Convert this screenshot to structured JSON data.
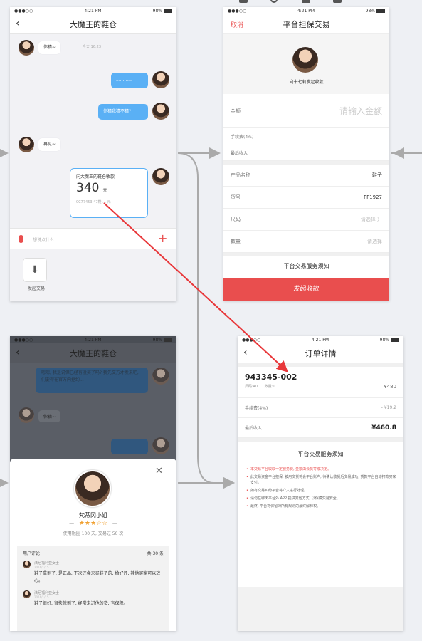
{
  "status": {
    "carrier": "●●●○○",
    "time": "4:21 PM",
    "battery": "98%"
  },
  "screen1": {
    "title": "大魔王的鞋仓",
    "messages": [
      {
        "side": "left",
        "text": "你猜~",
        "time": "今天 16:23"
      },
      {
        "side": "right",
        "text": "............"
      },
      {
        "side": "right",
        "text": "你猜我猜不猜?"
      },
      {
        "side": "left",
        "text": "再见~"
      }
    ],
    "card": {
      "title": "向大魔王的鞋仓收款",
      "amount": "340",
      "unit": "元",
      "order": "0C77453 47鞋 ... 元"
    },
    "input_placeholder": "想说点什么...",
    "tool_label": "发起交易"
  },
  "screen2": {
    "cancel": "取消",
    "title": "平台担保交易",
    "payee": "向十七莉发起收款",
    "amount_label": "金额",
    "amount_placeholder": "请输入金额",
    "fee_label": "手续费(4%)",
    "final_label": "最后收入",
    "rows": [
      {
        "label": "产品名称",
        "value": "鞋子",
        "placeholder": false
      },
      {
        "label": "货号",
        "value": "FF1927",
        "placeholder": false
      },
      {
        "label": "尺码",
        "value": "请选择 〉",
        "placeholder": true
      },
      {
        "label": "数量",
        "value": "请选择",
        "placeholder": true
      }
    ],
    "notice": "平台交易服务须知",
    "submit": "发起收款"
  },
  "screen3": {
    "title": "大魔王的鞋仓",
    "blue_text": "嗯嗯, 我是说但已经有没买了吗? 我先交方才发来吧, 们要得在官方内据约...",
    "reply": "你猜~",
    "seller": {
      "name": "梵蒂冈小姐",
      "stars": 3,
      "stars_text": "★★★☆☆",
      "stats": "使用融圈 100 天, 交易过 50 次",
      "reviews_title": "用户评论",
      "reviews_count": "共 30 条",
      "reviews": [
        {
          "user": "法尼福利亚女士",
          "date": "2016/1/15",
          "text": "鞋子拿到了, 是正品, 下次还会来买鞋子的, 给好评, 其他买家可以放心。"
        },
        {
          "user": "法尼福利亚女士",
          "date": "2016/1/15",
          "text": "鞋子很好, 很快就到了, 经常来进他的货, 有保障。"
        }
      ]
    }
  },
  "screen4": {
    "title": "订单详情",
    "order_no": "943345-002",
    "meta": "尺码:40      数量:1",
    "price": "¥480",
    "fee_label": "手续费(4%)",
    "fee_value": "- ¥19.2",
    "final_label": "最后收入",
    "final_value": "¥460.8",
    "notice_title": "平台交易服务须知",
    "rules": [
      {
        "text": "本交易平台收取一定服务费, 金额由会员等级决定。",
        "red": true
      },
      {
        "text": "此交易资金平台担保, 被用交货将会平台账户, 待确认收货后交易成功, 货款平台自动打款买家支付。",
        "red": false
      },
      {
        "text": "如有交易纠纷平台将介入进行处理。",
        "red": false
      },
      {
        "text": "请勿在聊天平台外 APP 提供其他方式, 以保障交易安全。",
        "red": false
      },
      {
        "text": "最终, 平台将保留对所有规则的最终解释权。",
        "red": false
      }
    ]
  },
  "colors": {
    "accent": "#e94e4e",
    "bubble": "#5ab0f5",
    "arrow": "#e8373a",
    "flow": "#aaaaaa"
  }
}
